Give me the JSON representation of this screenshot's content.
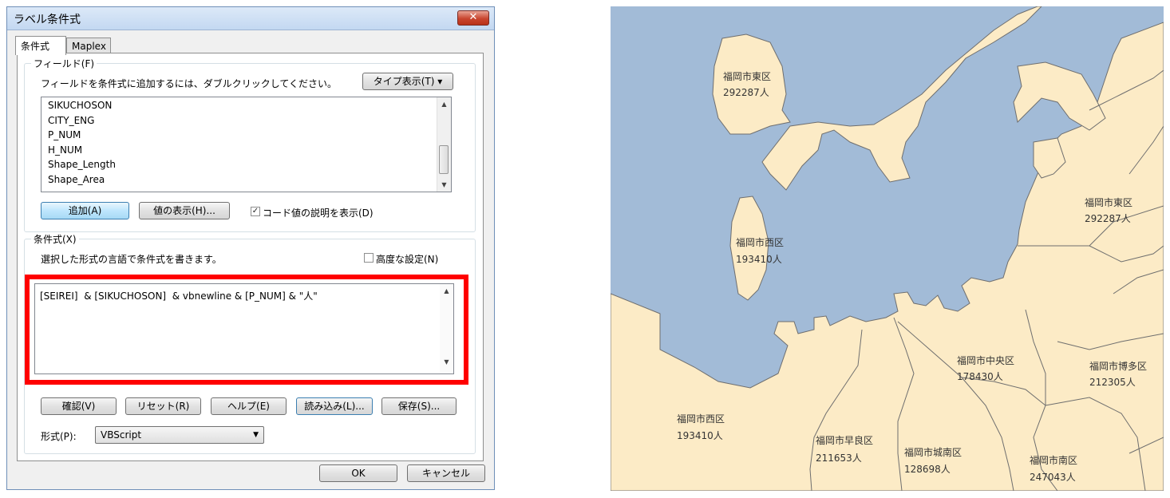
{
  "dialog": {
    "title": "ラベル条件式",
    "close_glyph": "✕",
    "tabs": [
      {
        "label": "条件式"
      },
      {
        "label": "Maplex"
      }
    ],
    "fields_group": {
      "legend": "フィールド(F)",
      "instruction": "フィールドを条件式に追加するには、ダブルクリックしてください。",
      "type_button": "タイプ表示(T) ▾",
      "items": [
        "SIKUCHOSON",
        "CITY_ENG",
        "P_NUM",
        "H_NUM",
        "Shape_Length",
        "Shape_Area"
      ],
      "add_button": "追加(A)",
      "show_values_button": "値の表示(H)...",
      "show_description_label": "コード値の説明を表示(D)",
      "show_description_checked": true
    },
    "expression_group": {
      "legend": "条件式(X)",
      "instruction": "選択した形式の言語で条件式を書きます。",
      "advanced_label": "高度な設定(N)",
      "advanced_checked": false,
      "expression": "[SEIREI]  & [SIKUCHOSON]  & vbnewline & [P_NUM] & \"人\""
    },
    "buttons": {
      "verify": "確認(V)",
      "reset": "リセット(R)",
      "help": "ヘルプ(E)",
      "load": "読み込み(L)...",
      "save": "保存(S)..."
    },
    "parser": {
      "label": "形式(P):",
      "value": "VBScript"
    },
    "ok": "OK",
    "cancel": "キャンセル"
  },
  "map": {
    "colors": {
      "water": "#a2bbd7",
      "land": "#fcebc6",
      "boundary": "#6e6e6e"
    },
    "labels": [
      {
        "name": "福岡市東区",
        "value": "292287人"
      },
      {
        "name": "福岡市東区",
        "value": "292287人"
      },
      {
        "name": "福岡市西区",
        "value": "193410人"
      },
      {
        "name": "福岡市中央区",
        "value": "178430人"
      },
      {
        "name": "福岡市博多区",
        "value": "212305人"
      },
      {
        "name": "福岡市西区",
        "value": "193410人"
      },
      {
        "name": "福岡市早良区",
        "value": "211653人"
      },
      {
        "name": "福岡市城南区",
        "value": "128698人"
      },
      {
        "name": "福岡市南区",
        "value": "247043人"
      }
    ]
  }
}
